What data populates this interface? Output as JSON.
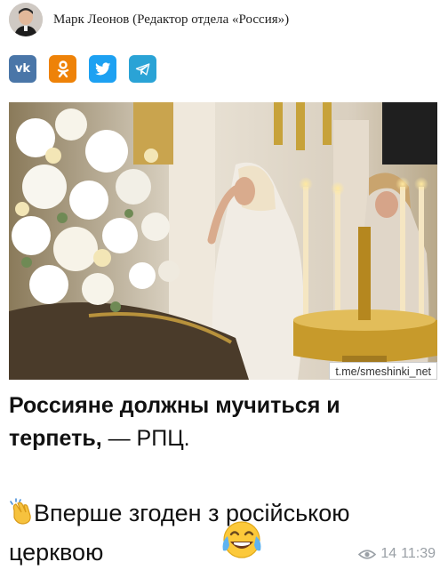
{
  "author": {
    "name": "Марк Леонов (Редактор отдела «Россия»)"
  },
  "share": [
    {
      "name": "vk",
      "label": "vk",
      "color": "#4a76a8"
    },
    {
      "name": "ok",
      "label": "ok",
      "color": "#ee8208"
    },
    {
      "name": "twitter",
      "label": "twitter",
      "color": "#1da1f2"
    },
    {
      "name": "telegram",
      "label": "telegram",
      "color": "#2aa3d6"
    }
  ],
  "photo": {
    "watermark": "t.me/smeshinki_net"
  },
  "headline": {
    "bold": "Россияне должны мучиться и терпеть,",
    "rest": " — РПЦ."
  },
  "comment": {
    "text": "Вперше згоден з російською церквою"
  },
  "meta": {
    "views": "14",
    "time": "11:39"
  }
}
